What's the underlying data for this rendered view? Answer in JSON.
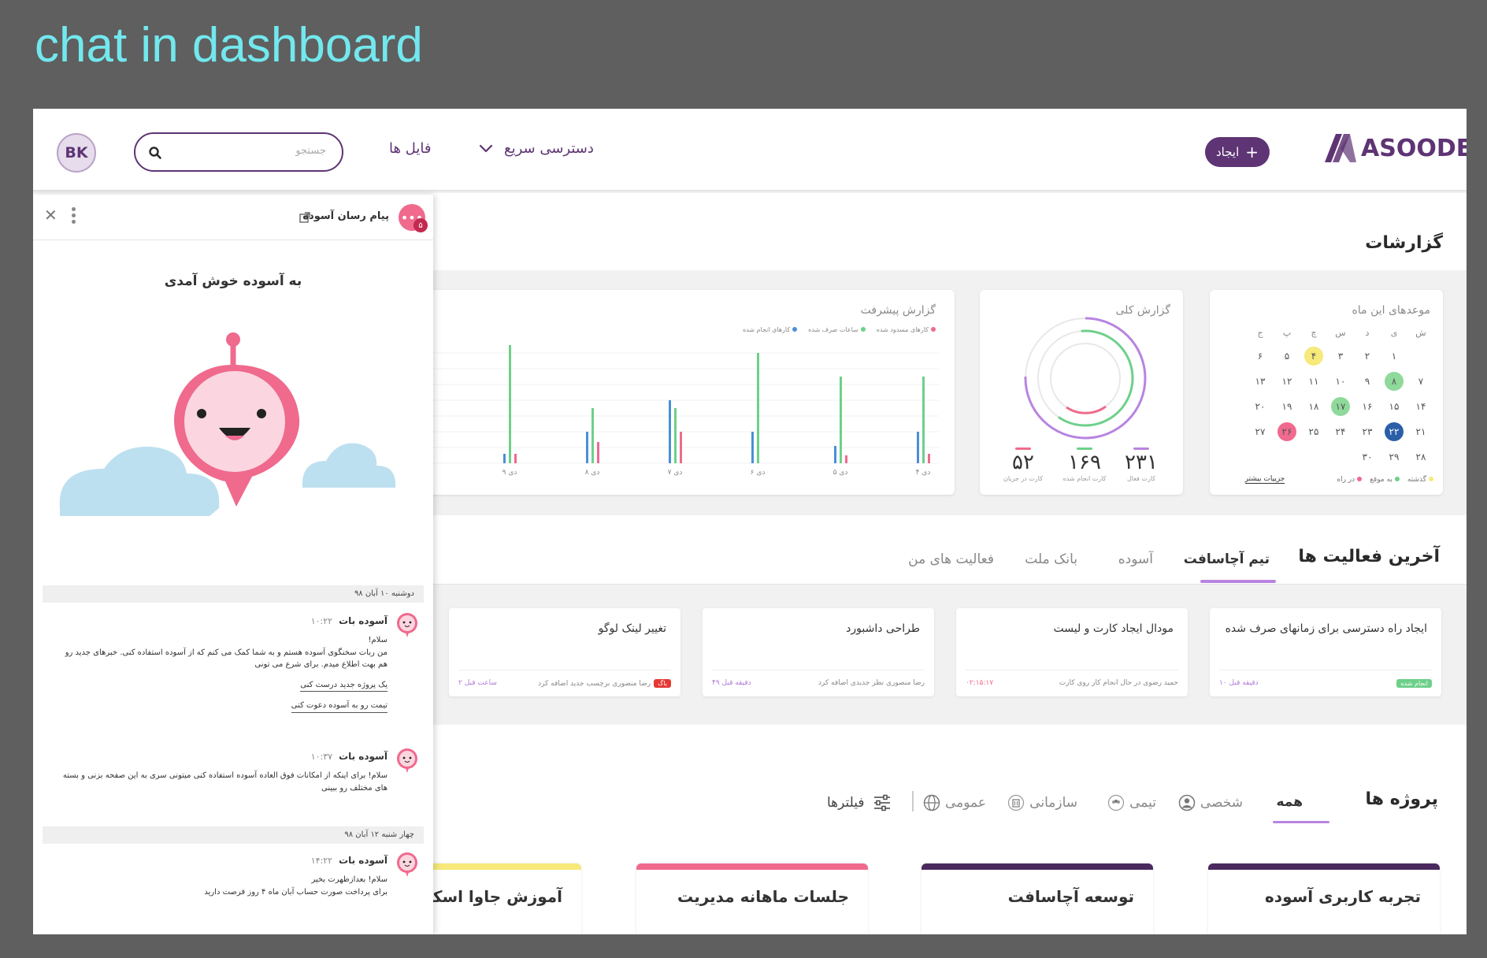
{
  "caption": "chat in dashboard",
  "header": {
    "avatar_initials": "BK",
    "search_placeholder": "جستجو",
    "nav_files": "فایل ها",
    "nav_quick_access": "دسترسی سریع",
    "create_label": "ایجاد",
    "logo_text": "ASOODE"
  },
  "reports": {
    "title": "گزارشات",
    "calendar": {
      "title": "موعدهای این ماه",
      "weekdays": [
        "ش",
        "ی",
        "د",
        "س",
        "چ",
        "پ",
        "ج"
      ],
      "rows": [
        [
          "",
          "۱",
          "۲",
          "۳",
          "۴",
          "۵",
          "۶"
        ],
        [
          "۷",
          "۸",
          "۹",
          "۱۰",
          "۱۱",
          "۱۲",
          "۱۳"
        ],
        [
          "۱۴",
          "۱۵",
          "۱۶",
          "۱۷",
          "۱۸",
          "۱۹",
          "۲۰"
        ],
        [
          "۲۱",
          "۲۲",
          "۲۳",
          "۲۴",
          "۲۵",
          "۲۶",
          "۲۷"
        ],
        [
          "۲۸",
          "۲۹",
          "۳۰",
          "",
          "",
          "",
          ""
        ]
      ],
      "legend": [
        "گذشته",
        "به موقع",
        "در راه"
      ],
      "details_link": "جزییات بیشتر",
      "colors": {
        "past": "#f7e97a",
        "ontime": "#8fd99b",
        "incoming": "#ef6a8d",
        "today": "#2b5fa8"
      }
    },
    "overall": {
      "title": "گزارش کلی",
      "stats": [
        {
          "value": "۲۳۱",
          "label": "کارت فعال",
          "color": "#b884e0"
        },
        {
          "value": "۱۶۹",
          "label": "کارت انجام شده",
          "color": "#6dd08a"
        },
        {
          "value": "۵۲",
          "label": "کارت در جریان",
          "color": "#ef6a8d"
        }
      ]
    },
    "progress": {
      "title": "گزارش پیشرفت",
      "legend": [
        {
          "label": "کارهای مسدود شده",
          "color": "#ef6a8d"
        },
        {
          "label": "ساعات صرف شده",
          "color": "#6dd08a"
        },
        {
          "label": "کارهای انجام شده",
          "color": "#4a8fd8"
        }
      ]
    }
  },
  "chart_data": {
    "type": "bar",
    "title": "گزارش پیشرفت",
    "categories": [
      "۴ دی",
      "۵ دی",
      "۶ دی",
      "۷ دی",
      "۸ دی",
      "۹ دی"
    ],
    "series": [
      {
        "name": "کارهای انجام شده",
        "values": [
          40,
          22,
          40,
          80,
          40,
          12
        ]
      },
      {
        "name": "ساعات صرف شده",
        "values": [
          110,
          110,
          140,
          70,
          70,
          150
        ]
      },
      {
        "name": "کارهای مسدود شده",
        "values": [
          12,
          10,
          0,
          40,
          27,
          12
        ]
      }
    ]
  },
  "activities": {
    "title": "آخرین فعالیت ها",
    "tabs": [
      "تیم آچاسافت",
      "آسوده",
      "بانک ملت",
      "فعالیت های من"
    ],
    "cards": [
      {
        "title": "ایجاد راه دسترسی برای زمانهای صرف شده",
        "badge": "انجام شده",
        "badge_color": "#6dd08a",
        "who": "",
        "when": "۱۰ دقیقه قبل"
      },
      {
        "title": "مودال ایجاد کارت و لیست",
        "badge": "",
        "badge_color": "",
        "who": "حمید رضوی در حال انجام کار روی کارت",
        "when": "۰۲:۱۵:۱۷"
      },
      {
        "title": "طراحی داشبورد",
        "badge": "",
        "badge_color": "",
        "who": "رضا منصوری نظر جدیدی اضافه کرد",
        "when": "۴۹ دقیقه قبل"
      },
      {
        "title": "تغییر لینک لوگو",
        "badge": "باگ",
        "badge_color": "#e53935",
        "who": "رضا منصوری برچسب جدید اضافه کرد",
        "when": "۲ ساعت قبل"
      }
    ]
  },
  "projects": {
    "title": "پروژه ها",
    "tabs": [
      "همه",
      "شخصی",
      "تیمی",
      "سازمانی",
      "عمومی"
    ],
    "filters_label": "فیلترها",
    "cards": [
      {
        "name": "تجربه کاربری آسوده",
        "color": "#4a2a5e"
      },
      {
        "name": "توسعه آچاسافت",
        "color": "#4a2a5e"
      },
      {
        "name": "جلسات ماهانه مدیریت",
        "color": "#ef6a8d"
      },
      {
        "name": "آموزش جاوا اسکریپت",
        "color": "#f7e97a"
      }
    ]
  },
  "chat": {
    "title": "پیام رسان آسوده",
    "unread": "۵",
    "welcome": "به آسوده خوش آمدی",
    "date1": "دوشنبه ۱۰ آبان ۹۸",
    "date2": "چهار شنبه ۱۲ آبان ۹۸",
    "messages": [
      {
        "name": "آسوده بات",
        "time": "۱۰:۲۲",
        "lines": [
          "سلام!",
          "من ربات سخنگوی آسوده هستم و به شما کمک می کنم که از آسوده استفاده کنی. خبرهای جدید رو هم بهت اطلاع میدم. برای شرع می تونی"
        ],
        "links": [
          "یک پروژه جدید درست کنی",
          "تیمت رو به آسوده دعوت کنی"
        ]
      },
      {
        "name": "آسوده بات",
        "time": "۱۰:۳۷",
        "lines": [
          "سلام! برای اینکه از امکانات فوق العاده آسوده استفاده کنی میتونی سری به این صفحه بزنی و بسته های مختلف رو ببینی"
        ],
        "links": []
      },
      {
        "name": "آسوده بات",
        "time": "۱۴:۲۲",
        "lines": [
          "سلام! بعدازظهرت بخیر",
          "برای پرداخت صورت حساب آبان ماه ۴ روز فرصت دارید"
        ],
        "links": []
      }
    ]
  }
}
